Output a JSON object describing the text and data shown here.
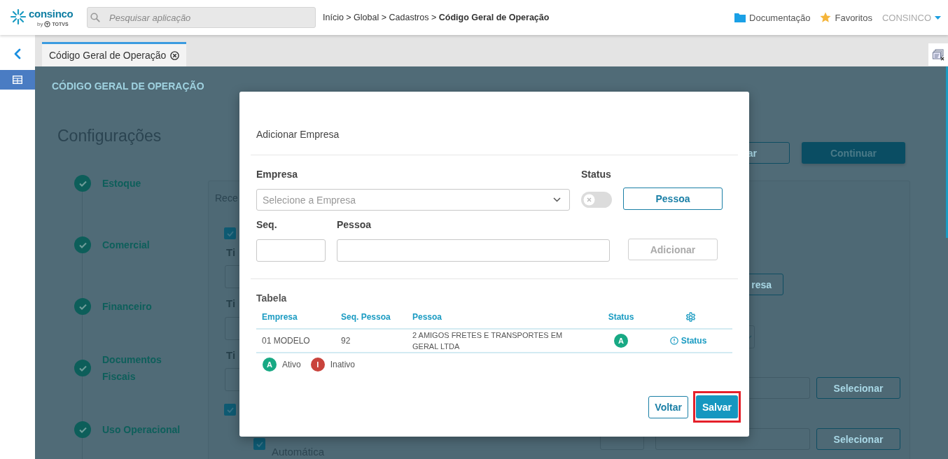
{
  "header": {
    "logo": {
      "name": "consinco",
      "by": "by",
      "brand": "TOTVS"
    },
    "search": {
      "placeholder": "Pesquisar aplicação"
    },
    "breadcrumb": "Início > Global > Cadastros > **Código Geral de Operação**",
    "links": [
      {
        "kind": "folder",
        "label": "Documentação"
      },
      {
        "kind": "star",
        "label": "Favoritos"
      }
    ],
    "user": {
      "label": "CONSINCO"
    }
  },
  "sidebar": {
    "items": [
      {
        "selected": true
      }
    ]
  },
  "tabs": [
    {
      "label": "Código Geral de Operação",
      "selected": true,
      "closable": true
    }
  ],
  "page": {
    "title": "CÓDIGO GERAL DE OPERAÇÃO",
    "heading": "Configurações",
    "steps": [
      {
        "label": "Estoque",
        "done": true
      },
      {
        "label": "Comercial",
        "done": true
      },
      {
        "label": "Financeiro",
        "done": true
      },
      {
        "label": "Documentos Fiscais",
        "done": true
      },
      {
        "label": "Uso Operacional",
        "done": true
      }
    ],
    "actions": [
      {
        "label": "ar",
        "kind": "outline"
      },
      {
        "label": "Continuar",
        "kind": "primary"
      }
    ],
    "card": {
      "title": "Rece",
      "items": [
        {
          "kind": "checkbox",
          "checked": true
        },
        {
          "kind": "label",
          "text": "Ti"
        },
        {
          "kind": "input"
        },
        {
          "kind": "label",
          "text": "Ti"
        },
        {
          "kind": "input"
        },
        {
          "kind": "label",
          "text": "Ti"
        },
        {
          "kind": "input"
        },
        {
          "kind": "checkbox",
          "checked": true
        },
        {
          "kind": "checkbox",
          "checked": true,
          "text": "Automática"
        },
        {
          "kind": "button",
          "label": "resa"
        },
        {
          "kind": "select"
        },
        {
          "kind": "input"
        },
        {
          "kind": "button",
          "label": "Selecionar"
        },
        {
          "kind": "input"
        },
        {
          "kind": "input"
        },
        {
          "kind": "button",
          "label": "Selecionar"
        }
      ]
    }
  },
  "dialog": {
    "title": "Adicionar Empresa",
    "form": {
      "empresa": {
        "label": "Empresa",
        "placeholder": "Selecione a Empresa"
      },
      "status": {
        "label": "Status",
        "on": false
      },
      "pessoa_button": {
        "label": "Pessoa"
      },
      "seq": {
        "label": "Seq."
      },
      "pessoa": {
        "label": "Pessoa"
      },
      "add_button": {
        "label": "Adicionar",
        "disabled": true
      }
    },
    "table": {
      "title": "Tabela",
      "columns": [
        "Empresa",
        "Seq. Pessoa",
        "Pessoa",
        "Status"
      ],
      "rows": [
        {
          "empresa": "01 MODELO",
          "seq": "92",
          "pessoa": "2 AMIGOS FRETES E TRANSPORTES EM GERAL LTDA",
          "status": {
            "label": "A",
            "color": "#18a984"
          },
          "action": "Status"
        }
      ]
    },
    "legend": [
      {
        "badge": "A",
        "label": "Ativo",
        "color": "#18a984"
      },
      {
        "badge": "I",
        "label": "Inativo",
        "color": "#c9433c"
      }
    ],
    "buttons": [
      {
        "label": "Voltar",
        "kind": "outline",
        "highlighted": false
      },
      {
        "label": "Salvar",
        "kind": "primary",
        "highlighted": true
      }
    ]
  }
}
